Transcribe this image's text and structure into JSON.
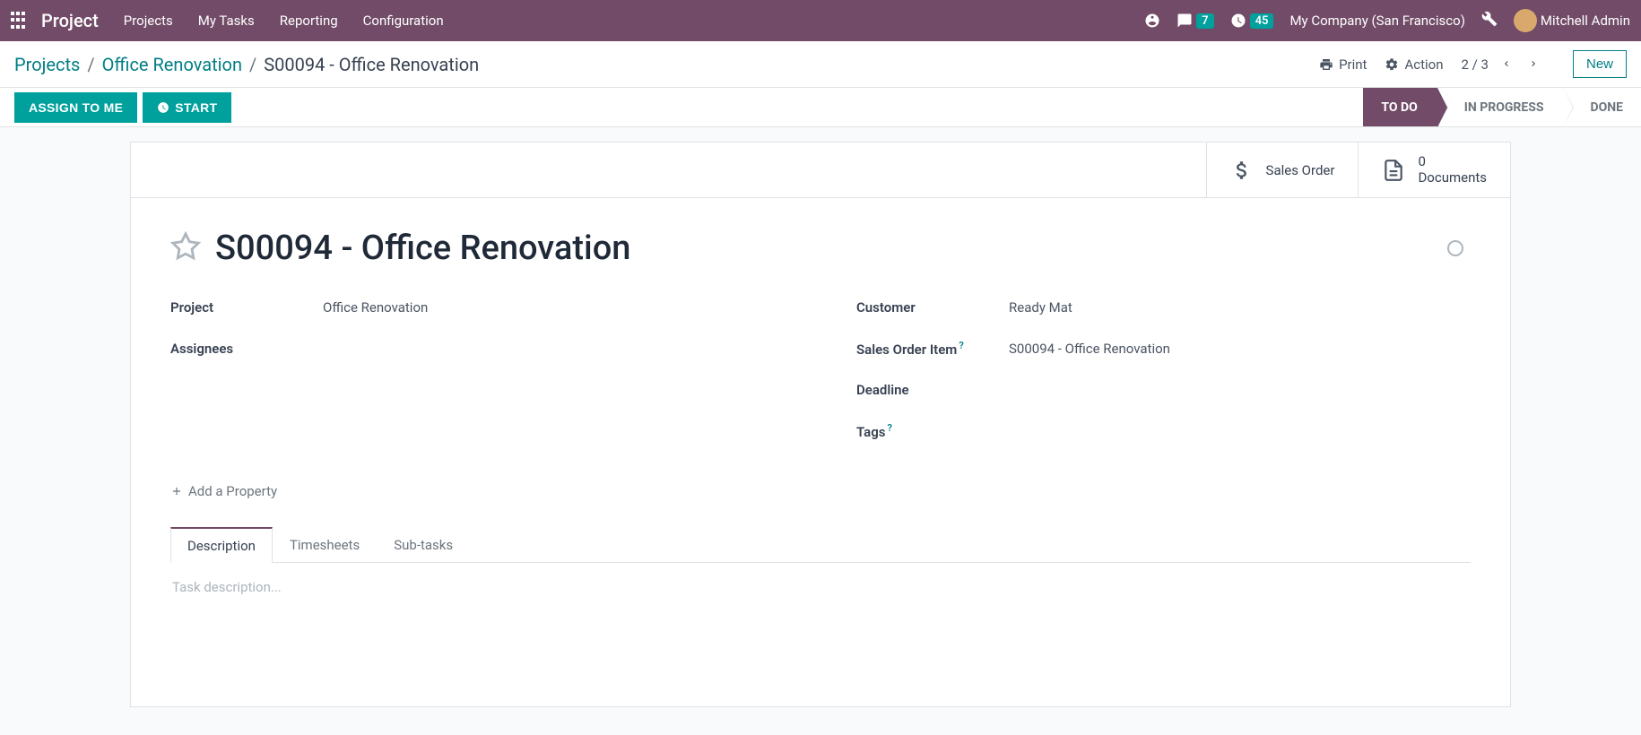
{
  "topnav": {
    "brand": "Project",
    "menu": [
      "Projects",
      "My Tasks",
      "Reporting",
      "Configuration"
    ],
    "messages_count": "7",
    "activities_count": "45",
    "company": "My Company (San Francisco)",
    "user": "Mitchell Admin"
  },
  "breadcrumb": {
    "root": "Projects",
    "parent": "Office Renovation",
    "current": "S00094 - Office Renovation"
  },
  "controlbar": {
    "print": "Print",
    "action": "Action",
    "pager": "2 / 3",
    "new": "New"
  },
  "statusbar": {
    "assign": "ASSIGN TO ME",
    "start": "START",
    "stages": {
      "todo": "TO DO",
      "in_progress": "IN PROGRESS",
      "done": "DONE"
    }
  },
  "stat_buttons": {
    "sales_order": "Sales Order",
    "documents_count": "0",
    "documents_label": "Documents"
  },
  "record": {
    "title": "S00094 - Office Renovation",
    "fields": {
      "project_label": "Project",
      "project_value": "Office Renovation",
      "assignees_label": "Assignees",
      "assignees_value": "",
      "customer_label": "Customer",
      "customer_value": "Ready Mat",
      "so_item_label": "Sales Order Item",
      "so_item_value": "S00094 - Office Renovation",
      "deadline_label": "Deadline",
      "deadline_value": "",
      "tags_label": "Tags",
      "tags_value": ""
    },
    "add_property": "Add a Property"
  },
  "tabs": {
    "description": "Description",
    "timesheets": "Timesheets",
    "subtasks": "Sub-tasks"
  },
  "description_placeholder": "Task description..."
}
